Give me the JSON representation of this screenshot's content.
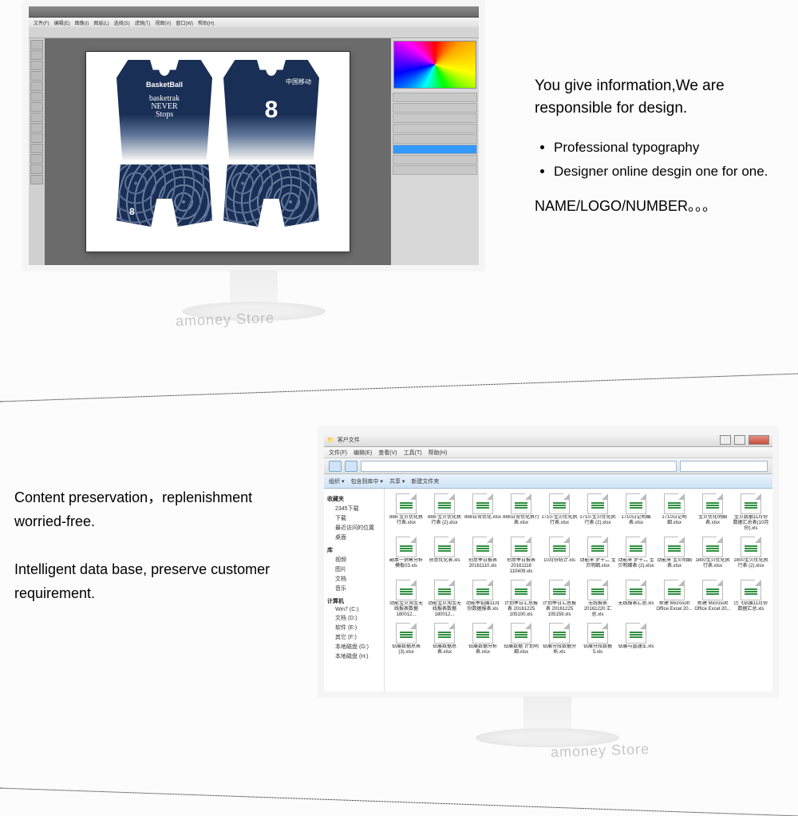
{
  "watermark": "amoney Store",
  "section1": {
    "headline": "You give information,We are responsible for design.",
    "bullets": [
      "Professional typography",
      "Designer online desgin one for one."
    ],
    "footer": "NAME/LOGO/NUMBER。。。",
    "ps": {
      "menus": [
        "文件(F)",
        "编辑(E)",
        "图像(I)",
        "图层(L)",
        "选择(S)",
        "滤镜(T)",
        "视图(V)",
        "窗口(W)",
        "帮助(H)"
      ],
      "jersey_front": {
        "brand": "BasketBall",
        "script_line1": "basketrak",
        "script_line2": "NEVER",
        "script_line3": "Stops",
        "shorts_num": "8"
      },
      "jersey_back": {
        "team": "中国移动",
        "number": "8"
      }
    }
  },
  "section2": {
    "p1": "Content preservation，replenishment worried-free.",
    "p2": "Intelligent data base, preserve customer requirement.",
    "win": {
      "title": "客户文件",
      "menus": [
        "文件(F)",
        "编辑(E)",
        "查看(V)",
        "工具(T)",
        "帮助(H)"
      ],
      "optrow": [
        "组织 ▾",
        "包含到库中 ▾",
        "共享 ▾",
        "新建文件夹"
      ],
      "sidebar_groups": [
        {
          "name": "收藏夹",
          "items": [
            "2345下载",
            "下载",
            "最近访问的位置",
            "桌面"
          ]
        },
        {
          "name": "库",
          "items": [
            "视频",
            "图片",
            "文档",
            "音乐"
          ]
        },
        {
          "name": "计算机",
          "items": [
            "Win7 (C:)",
            "文档 (D:)",
            "软件 (E:)",
            "其它 (F:)",
            "本地磁盘 (G:)",
            "本地磁盘 (H:)"
          ]
        }
      ],
      "files": [
        "888-宝贝优化执行表.xlsx",
        "888-宝贝优化执行表 (2).xlsx",
        "888日常优化.xlsx",
        "888日常优化执行表.xlsx",
        "1710-宝贝优化执行表.xlsx",
        "1710-宝贝优化执行表 (2).xlsx",
        "1710日记明细表.xlsx",
        "1710日记明细.xlsx",
        "宝贝优化明细表.xlsx",
        "宝贝数据11月份数据汇总表(10月份).xls",
        "副本一销售分析模板03.xls",
        "创意优化表.xls",
        "创意季日报表20161110.xls",
        "创意季日报表20161118 110409.xls",
        "10月份统计.xls",
        "动能来 梦十二 宝贝明细.xlsx",
        "动能来 梦十二 宝贝明细表 (2).xlsx",
        "动能来 宝贝明细表.xlsx",
        "1800宝贝优化执行表.xlsx",
        "1800宝贝优化执行表 (2).xlsx",
        "动能宝贝淘宝无线报表数据180012...",
        "动能宝贝淘宝无线报表数据180012...",
        "动能季铂展11月份数据报表.xls",
        "计划季日汇总报表 20161225 105100.xls",
        "计划季日汇总报表 20161225 105159.xls",
        "无线报表 20161220 汇总.xls",
        "无线报表汇总.xls",
        "新建 Microsoft Office Excel 20...",
        "新建 Microsoft Office Excel 20...",
        "历飞钻展11月份数据汇总.xls",
        "钻展数据总表(3).xlsx",
        "钻展数据总表.xlsx",
        "钻展数据分析表.xlsx",
        "钻展数据 计划明细.xlsx",
        "钻展分段数据分析.xls",
        "钻展分段数据5.xls",
        "钻展与直通车.xls"
      ]
    }
  }
}
